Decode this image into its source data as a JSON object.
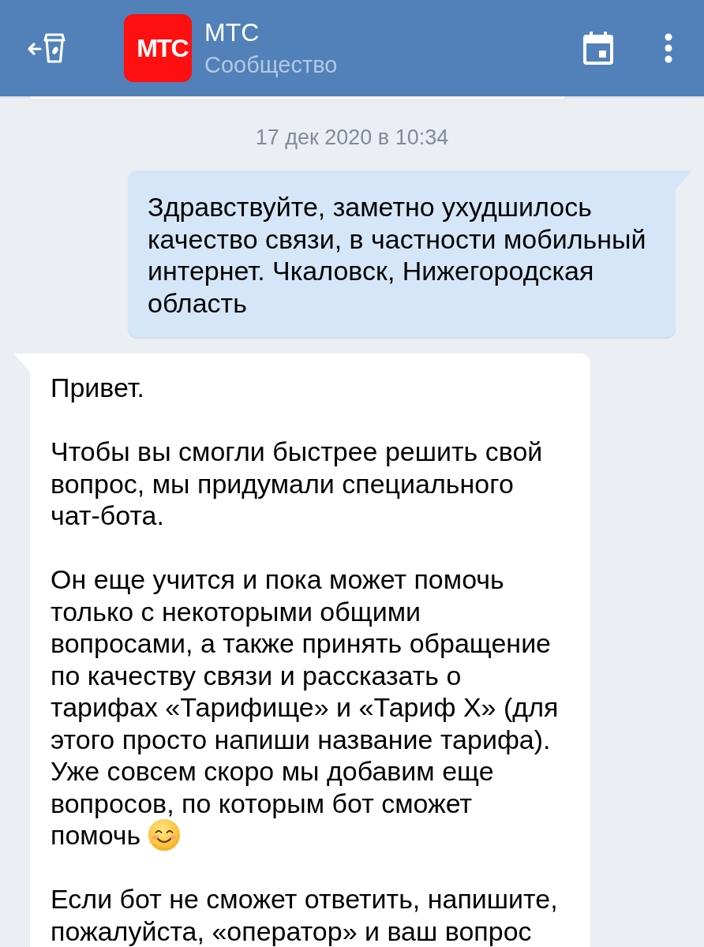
{
  "header": {
    "avatar_logo": "МТС",
    "title": "МТС",
    "subtitle": "Сообщество"
  },
  "thread": [
    {
      "kind": "bubble-edge",
      "outgoing": false
    },
    {
      "kind": "date",
      "text": "17 дек 2020 в 10:34"
    },
    {
      "kind": "message",
      "outgoing": true,
      "continues_below": false,
      "paragraphs": [
        {
          "text": "Здравствуйте, заметно ухудшилось\nкачество связи, в частности мобильный\nинтернет. Чкаловск, Нижегородская\nобласть",
          "ends_with_emoji": false
        }
      ]
    },
    {
      "kind": "message",
      "outgoing": false,
      "continues_below": true,
      "paragraphs": [
        {
          "text": "Привет.",
          "ends_with_emoji": false
        },
        {
          "text": "Чтобы вы смогли быстрее решить свой\nвопрос, мы придумали специального\nчат-бота.",
          "ends_with_emoji": false
        },
        {
          "text": "Он еще учится и пока может помочь\nтолько с некоторыми общими\nвопросами, а также принять обращение\nпо качеству связи и рассказать о\nтарифах «Тарифище» и «Тариф Х» (для\nэтого просто напиши название тарифа).\nУже совсем скоро мы добавим еще\nвопросов, по которым бот сможет\nпомочь",
          "ends_with_emoji": true
        },
        {
          "text": "Если бот не сможет ответить, напишите,\nпожалуйста, «оператор» и ваш вопрос",
          "ends_with_emoji": false
        }
      ]
    }
  ]
}
